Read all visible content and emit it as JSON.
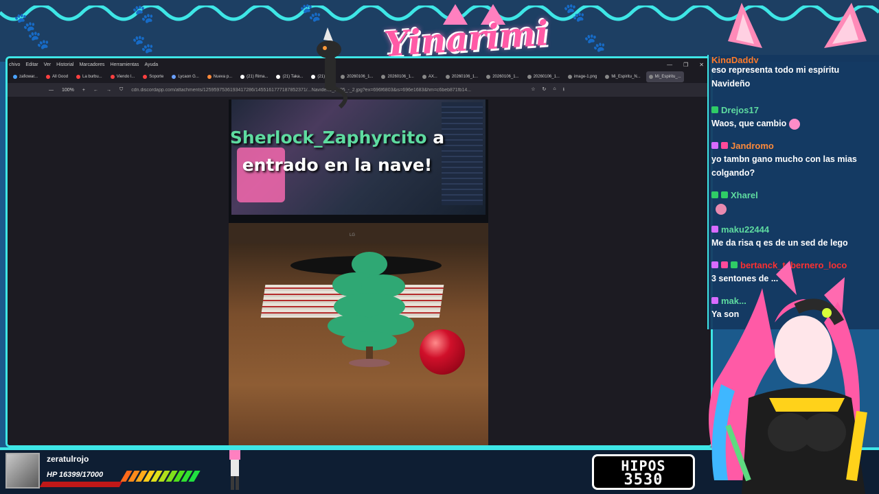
{
  "logo": {
    "text": "Yinarimi"
  },
  "browser": {
    "menu": [
      "chivo",
      "Editar",
      "Ver",
      "Historial",
      "Marcadores",
      "Herramientas",
      "Ayuda"
    ],
    "tabs": [
      {
        "label": "zafiowar...",
        "color": "#4aa3ff"
      },
      {
        "label": "All Good",
        "color": "#ff4040"
      },
      {
        "label": "La burbu...",
        "color": "#ff4040"
      },
      {
        "label": "Viendo l...",
        "color": "#ff4040"
      },
      {
        "label": "Soporte",
        "color": "#ff4040"
      },
      {
        "label": "Lycaon G...",
        "color": "#6aa0ff"
      },
      {
        "label": "Nueva p...",
        "color": "#ff8a3a"
      },
      {
        "label": "(21) Rima...",
        "color": "#ffffff"
      },
      {
        "label": "(21) Taka...",
        "color": "#ffffff"
      },
      {
        "label": "(21) H...",
        "color": "#ffffff"
      },
      {
        "label": "20260106_1...",
        "color": "#888888"
      },
      {
        "label": "20260106_1...",
        "color": "#888888"
      },
      {
        "label": "AX...",
        "color": "#888888"
      },
      {
        "label": "20260106_1...",
        "color": "#888888"
      },
      {
        "label": "20260106_1...",
        "color": "#888888"
      },
      {
        "label": "20260106_1...",
        "color": "#888888"
      },
      {
        "label": "image-1.png",
        "color": "#888888"
      },
      {
        "label": "Mi_Espiritu_N...",
        "color": "#888888"
      },
      {
        "label": "Mi_Espiritu_...",
        "color": "#888888",
        "active": true
      }
    ],
    "zoom": "100%",
    "url": "cdn.discordapp.com/attachments/1259597536193417286/1455161777187852371/...Navideno_2005_-_2.jpg?ex=696f6803&is=696e1683&hm=c6beb871fb14...",
    "lg_label": "LG"
  },
  "alert": {
    "username": "Sherlock_Zaphyrcito",
    "line1_rest": " a",
    "line2": "entrado en la nave!"
  },
  "chat": {
    "messages": [
      {
        "user": "KingDaddy",
        "text": "eso representa todo mi espíritu Navideño",
        "color": "#ff7b2a"
      },
      {
        "user": "Drejos17",
        "text": "Waos, que cambio",
        "color": "#5edba0"
      },
      {
        "user": "Jandromo",
        "text": "yo tambn gano mucho con las mias colgando?",
        "color": "#ff8a3a"
      },
      {
        "user": "Xharel",
        "text": "",
        "color": "#5edba0"
      },
      {
        "user": "maku22444",
        "text": "Me da risa q es de un sed de lego",
        "color": "#5edba0"
      },
      {
        "user": "bertanck_tabernero_loco",
        "text": "3 sentones de ...",
        "color": "#ff3030"
      },
      {
        "user": "mak...",
        "text": "Ya son",
        "color": "#5edba0"
      }
    ]
  },
  "hud": {
    "username": "zeratulrojo",
    "hp": "HP 16399/17000",
    "hp_fraction": 0.9647,
    "hipos_label": "HIPOS",
    "hipos_value": "3530"
  }
}
